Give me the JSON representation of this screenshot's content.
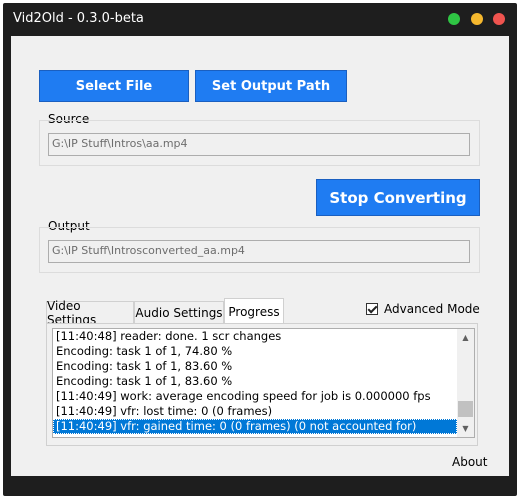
{
  "window": {
    "title": "Vid2Old - 0.3.0-beta",
    "controls": [
      "green-dot",
      "yellow-dot",
      "red-dot"
    ]
  },
  "buttons": {
    "select_file": "Select File",
    "set_output_path": "Set Output Path",
    "stop_converting": "Stop Converting"
  },
  "source": {
    "label": "Source",
    "value": "G:\\IP Stuff\\Intros\\aa.mp4"
  },
  "output": {
    "label": "Output",
    "value": "G:\\IP Stuff\\Introsconverted_aa.mp4"
  },
  "tabs": [
    {
      "label": "Video Settings",
      "active": false
    },
    {
      "label": "Audio Settings",
      "active": false
    },
    {
      "label": "Progress",
      "active": true
    }
  ],
  "advanced_mode": {
    "label": "Advanced Mode",
    "checked": true
  },
  "log": [
    "[11:40:48] reader: done. 1 scr changes",
    "Encoding: task 1 of 1, 74.80 %",
    "Encoding: task 1 of 1, 83.60 %",
    "Encoding: task 1 of 1, 83.60 %",
    "[11:40:49] work: average encoding speed for job is 0.000000 fps",
    "[11:40:49] vfr: lost time: 0 (0 frames)",
    "[11:40:49] vfr: gained time: 0 (0 frames) (0 not accounted for)"
  ],
  "selected_log_index": 6,
  "about_link": "About",
  "colors": {
    "accent": "#1f7cf2",
    "titlebar": "#1e1e1e",
    "selection": "#0078d7"
  }
}
